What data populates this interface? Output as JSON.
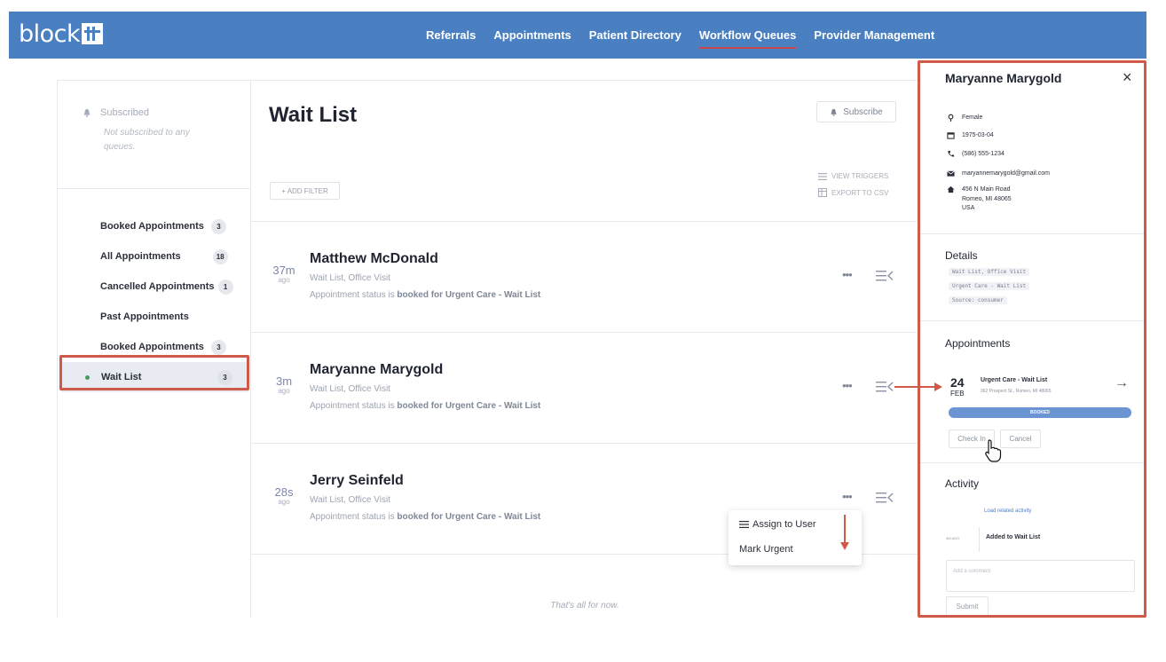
{
  "app": {
    "logo_text": "block"
  },
  "nav": {
    "items": [
      {
        "label": "Referrals"
      },
      {
        "label": "Appointments"
      },
      {
        "label": "Patient Directory"
      },
      {
        "label": "Workflow Queues",
        "active": true
      },
      {
        "label": "Provider Management"
      }
    ]
  },
  "sidebar": {
    "subscribed_label": "Subscribed",
    "subscribed_note": "Not subscribed to any queues.",
    "queues": [
      {
        "label": "Booked Appointments",
        "count": "3"
      },
      {
        "label": "All Appointments",
        "count": "18"
      },
      {
        "label": "Cancelled Appointments",
        "count": "1"
      },
      {
        "label": "Past Appointments",
        "count": ""
      },
      {
        "label": "Booked Appointments",
        "count": "3"
      },
      {
        "label": "Wait List",
        "count": "3",
        "active": true
      }
    ]
  },
  "main": {
    "title": "Wait List",
    "subscribe_label": "Subscribe",
    "add_filter_label": "+ ADD FILTER",
    "view_triggers_label": "VIEW TRIGGERS",
    "export_label": "EXPORT TO CSV",
    "ago_label": "ago",
    "items": [
      {
        "time": "37m",
        "name": "Matthew McDonald",
        "tags": "Wait List, Office Visit",
        "status_prefix": "Appointment status is ",
        "status_bold": "booked for Urgent Care - Wait List"
      },
      {
        "time": "3m",
        "name": "Maryanne Marygold",
        "tags": "Wait List, Office Visit",
        "status_prefix": "Appointment status is ",
        "status_bold": "booked for Urgent Care - Wait List"
      },
      {
        "time": "28s",
        "name": "Jerry Seinfeld",
        "tags": "Wait List, Office Visit",
        "status_prefix": "Appointment status is ",
        "status_bold": "booked for Urgent Care - Wait List"
      }
    ],
    "more_label": "•••",
    "empty_note": "That's all for now."
  },
  "popover": {
    "assign_label": "Assign to User",
    "urgent_label": "Mark Urgent"
  },
  "panel": {
    "name": "Maryanne Marygold",
    "close_label": "×",
    "gender": "Female",
    "dob": "1975-03-04",
    "phone": "(586) 555-1234",
    "email": "maryannemarygold@gmail.com",
    "address_line1": "456 N Main Road",
    "address_line2": "Romeo, MI 48065",
    "address_line3": "USA",
    "details_heading": "Details",
    "details_chips": [
      "Wait List, Office Visit",
      "Urgent Care - Wait List",
      "Source: consumer"
    ],
    "appointments_heading": "Appointments",
    "appt_day": "24",
    "appt_month": "FEB",
    "appt_title": "Urgent Care - Wait List",
    "appt_address": "362 Prospect St., Romeo, MI 48065",
    "appt_status": "BOOKED",
    "check_in_label": "Check In",
    "cancel_label": "Cancel",
    "activity_heading": "Activity",
    "activity_link": "Load related activity",
    "activity_ago": "4M AGO",
    "activity_text": "Added to Wait List",
    "comment_placeholder": "Add a comment",
    "submit_label": "Submit"
  },
  "colors": {
    "nav_bg": "#4a80c2",
    "accent_red": "#d05a4a",
    "booked_blue": "#6a94d2",
    "active_dot": "#4a9b5a"
  }
}
